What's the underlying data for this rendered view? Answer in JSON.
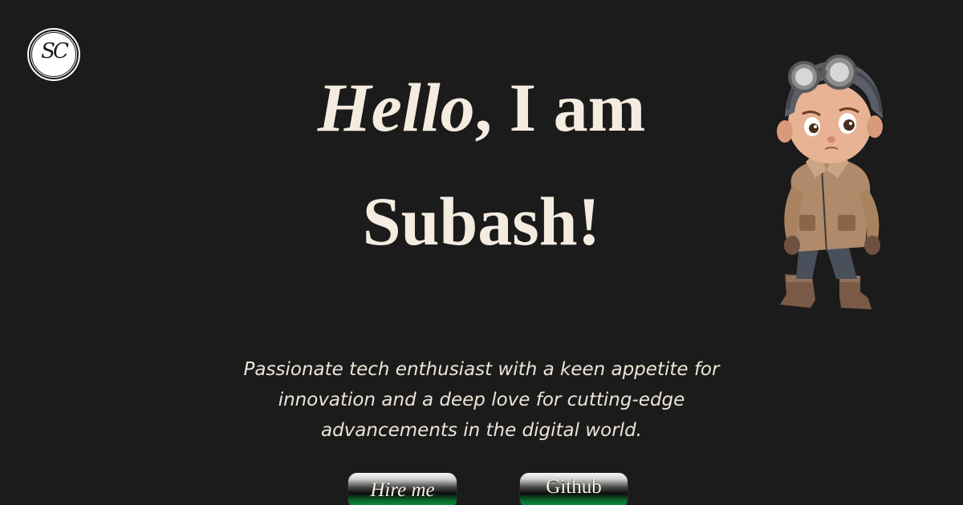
{
  "logo": {
    "text": "SC"
  },
  "hero": {
    "greeting_italic": "Hello",
    "greeting_rest": ", I am",
    "name": "Subash!",
    "tagline": "Passionate tech enthusiast with a keen appetite for innovation and a deep love for cutting-edge advancements in the digital world."
  },
  "buttons": {
    "hire_label": "Hire me",
    "github_label": "Github"
  },
  "colors": {
    "background": "#1b1b1b",
    "text": "#f4ece0",
    "button_green": "#11a348"
  },
  "illustration": {
    "icon": "aviator-boy-character"
  }
}
